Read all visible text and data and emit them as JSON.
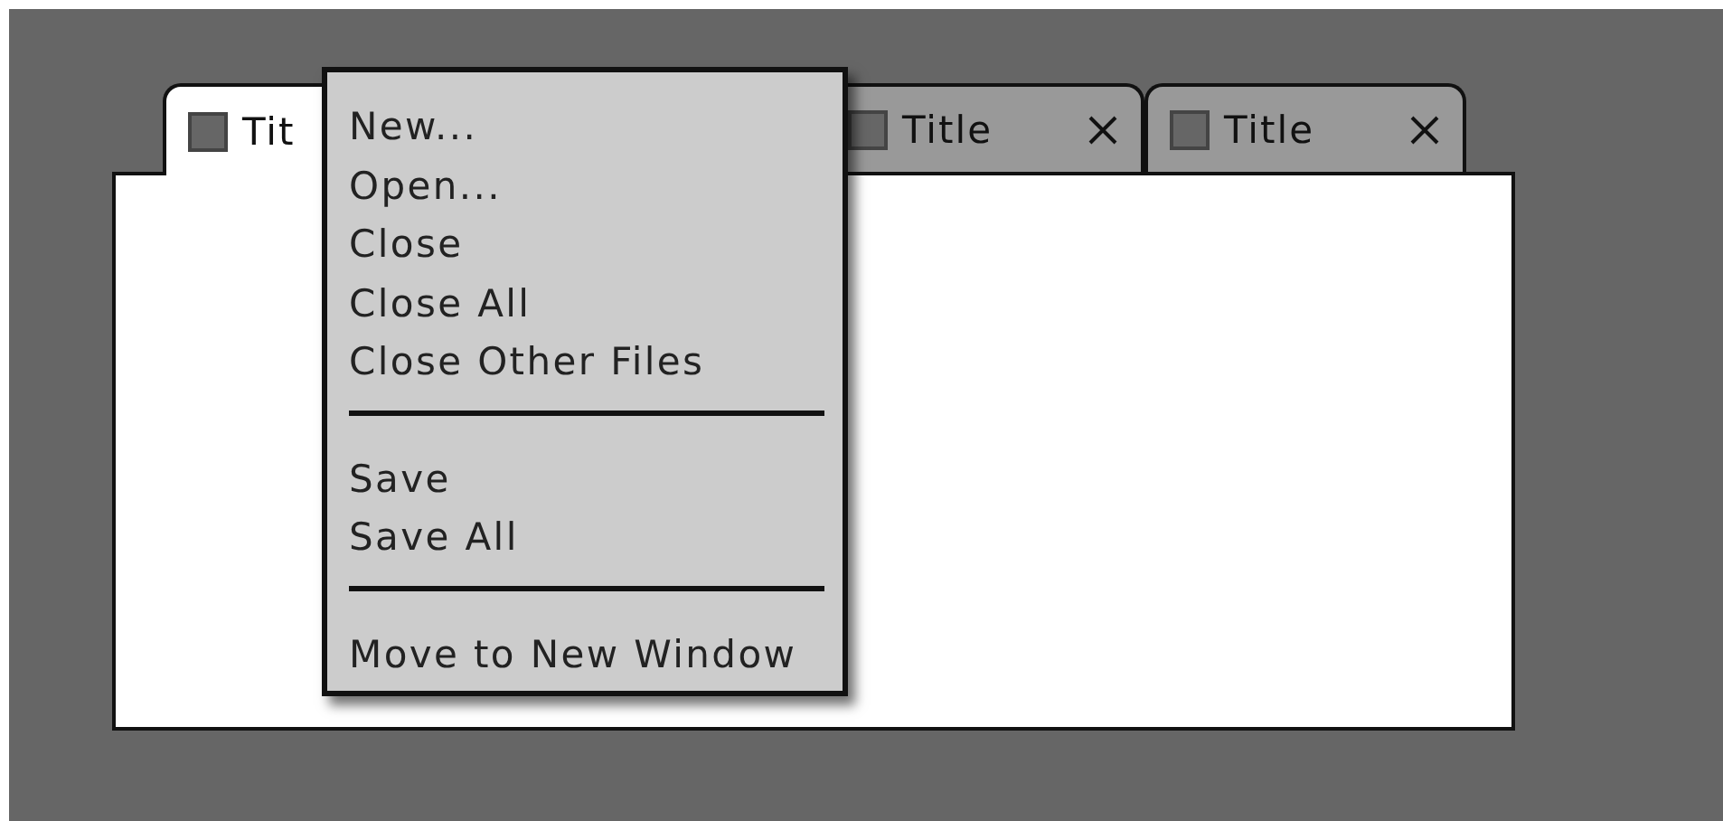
{
  "tabs": [
    {
      "label": "Tit",
      "selected": true,
      "closable": false
    },
    {
      "label": "Title",
      "selected": false,
      "closable": true
    },
    {
      "label": "Title",
      "selected": false,
      "closable": true
    }
  ],
  "context_menu": {
    "items": [
      {
        "kind": "item",
        "label": "New..."
      },
      {
        "kind": "item",
        "label": "Open..."
      },
      {
        "kind": "item",
        "label": "Close"
      },
      {
        "kind": "item",
        "label": "Close All"
      },
      {
        "kind": "item",
        "label": "Close Other Files"
      },
      {
        "kind": "separator"
      },
      {
        "kind": "item",
        "label": "Save"
      },
      {
        "kind": "item",
        "label": "Save All"
      },
      {
        "kind": "separator"
      },
      {
        "kind": "item",
        "label": "Move to New Window"
      }
    ]
  }
}
